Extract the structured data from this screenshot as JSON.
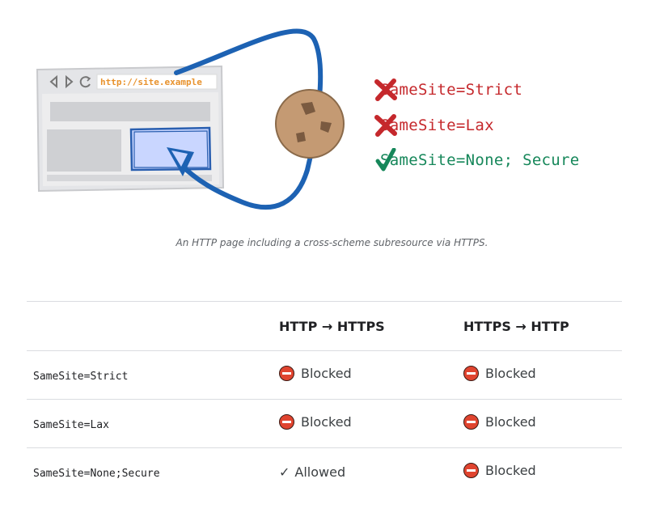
{
  "figure": {
    "url": "http://site.example",
    "rules": [
      {
        "label": "SameSite=Strict",
        "result": "blocked",
        "color": "#c5282c"
      },
      {
        "label": "SameSite=Lax",
        "result": "blocked",
        "color": "#c5282c"
      },
      {
        "label": "SameSite=None; Secure",
        "result": "allowed",
        "color": "#16875a"
      }
    ],
    "icons": [
      "browser-window-illustration",
      "cookie-icon",
      "cross-icon",
      "check-icon"
    ],
    "caption": "An HTTP page including a cross-scheme subresource via HTTPS."
  },
  "table": {
    "headers": [
      "",
      "HTTP → HTTPS",
      "HTTPS → HTTP"
    ],
    "rows": [
      {
        "attribute": "SameSite=Strict",
        "http_to_https": "Blocked",
        "https_to_http": "Blocked"
      },
      {
        "attribute": "SameSite=Lax",
        "http_to_https": "Blocked",
        "https_to_http": "Blocked"
      },
      {
        "attribute": "SameSite=None;Secure",
        "http_to_https": "Allowed",
        "https_to_http": "Blocked"
      }
    ],
    "allowed_glyph": "✓"
  }
}
